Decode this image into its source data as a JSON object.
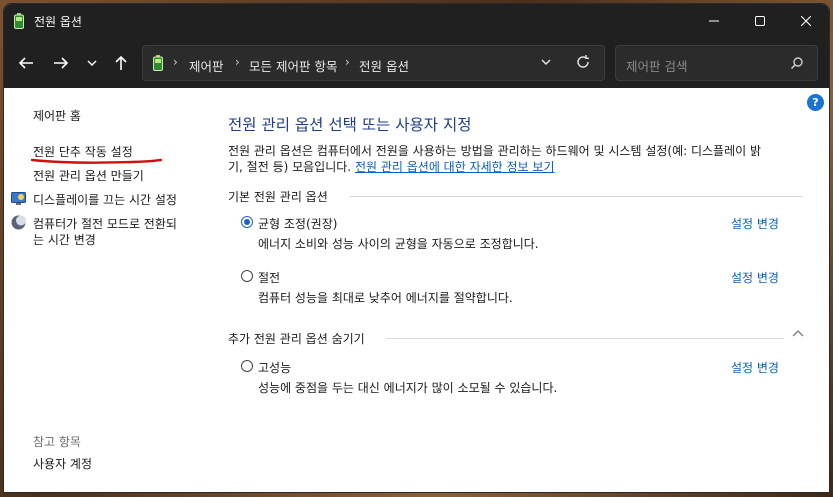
{
  "window": {
    "title": "전원 옵션"
  },
  "address_bar": {
    "breadcrumbs": [
      "제어판",
      "모든 제어판 항목",
      "전원 옵션"
    ]
  },
  "search": {
    "placeholder": "제어판 검색"
  },
  "sidebar": {
    "home": "제어판 홈",
    "items": [
      {
        "label": "전원 단추 작동 설정"
      },
      {
        "label": "전원 관리 옵션 만들기"
      },
      {
        "label": "디스플레이를 끄는 시간 설정",
        "icon": "display-icon"
      },
      {
        "label_line1": "컴퓨터가 절전 모드로 전환되",
        "label_line2": "는 시간 변경",
        "icon": "moon-icon"
      }
    ],
    "see_also_title": "참고 항목",
    "see_also_items": [
      "사용자 계정"
    ]
  },
  "main": {
    "title": "전원 관리 옵션 선택 또는 사용자 지정",
    "desc_line1": "전원 관리 옵션은 컴퓨터에서 전원을 사용하는 방법을 관리하는 하드웨어 및 시스템 설정(예: 디스플레이 밝",
    "desc_line2": "기, 절전 등) 모음입니다.",
    "desc_link": "전원 관리 옵션에 대한 자세한 정보 보기",
    "basic_section": "기본 전원 관리 옵션",
    "extra_section": "추가 전원 관리 옵션 숨기기",
    "change_label": "설정 변경",
    "plans": [
      {
        "name": "균형 조정(권장)",
        "desc": "에너지 소비와 성능 사이의 균형을 자동으로 조정합니다.",
        "selected": true
      },
      {
        "name": "절전",
        "desc": "컴퓨터 성능을 최대로 낮추어 에너지를 절약합니다.",
        "selected": false
      },
      {
        "name": "고성능",
        "desc": "성능에 중점을 두는 대신 에너지가 많이 소모될 수 있습니다.",
        "selected": false
      }
    ]
  },
  "colors": {
    "link": "#0b5fbf",
    "title_blue": "#1e3e8c",
    "annotation_red": "#d01010"
  }
}
